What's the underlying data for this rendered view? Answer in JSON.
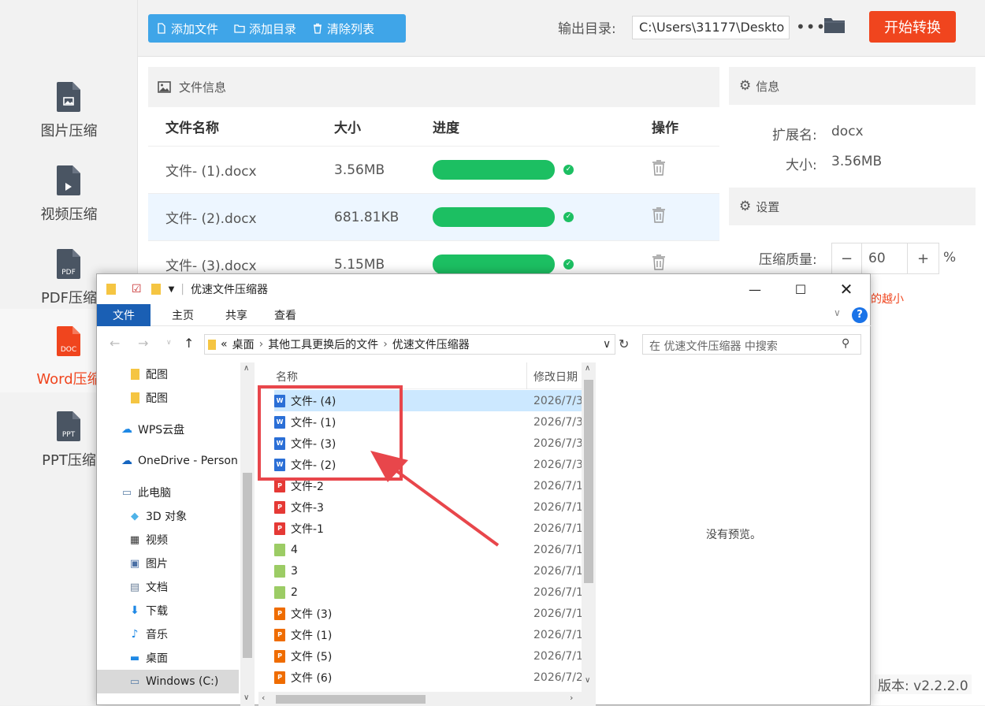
{
  "sidebar": {
    "items": [
      {
        "label": "图片压缩",
        "icon": "image-file-icon",
        "badge": ""
      },
      {
        "label": "视频压缩",
        "icon": "video-file-icon",
        "badge": ""
      },
      {
        "label": "PDF压缩",
        "icon": "pdf-file-icon",
        "badge": "PDF"
      },
      {
        "label": "Word压缩",
        "icon": "word-file-icon",
        "badge": "DOC"
      },
      {
        "label": "PPT压缩",
        "icon": "ppt-file-icon",
        "badge": "PPT"
      }
    ],
    "active_index": 3
  },
  "toolbar": {
    "add_file": "添加文件",
    "add_dir": "添加目录",
    "clear_list": "清除列表",
    "output_label": "输出目录:",
    "output_path": "C:\\Users\\31177\\Deskto",
    "more": "•••",
    "start": "开始转换"
  },
  "file_panel": {
    "title": "文件信息",
    "columns": [
      "文件名称",
      "大小",
      "进度",
      "操作"
    ],
    "rows": [
      {
        "name": "文件- (1).docx",
        "size": "3.56MB",
        "progress": 1.0,
        "selected": false
      },
      {
        "name": "文件- (2).docx",
        "size": "681.81KB",
        "progress": 1.0,
        "selected": true
      },
      {
        "name": "文件- (3).docx",
        "size": "5.15MB",
        "progress": 1.0,
        "selected": false
      }
    ]
  },
  "info_panel": {
    "title": "信息",
    "ext_label": "扩展名:",
    "ext_value": "docx",
    "size_label": "大小:",
    "size_value": "3.56MB"
  },
  "settings_panel": {
    "title": "设置",
    "quality_label": "压缩质量:",
    "quality_value": "60",
    "minus": "−",
    "plus": "+",
    "unit": "%",
    "hint_fragment": "的越小"
  },
  "version": "版本:  v2.2.2.0",
  "explorer": {
    "title": "优速文件压缩器",
    "ribbon_tabs": [
      "文件",
      "主页",
      "共享",
      "查看"
    ],
    "address": {
      "prefix": "«",
      "crumbs": [
        "桌面",
        "其他工具更换后的文件",
        "优速文件压缩器"
      ]
    },
    "search_placeholder": "在 优速文件压缩器 中搜索",
    "nav_items": [
      {
        "label": "配图",
        "icon": "folder-icon"
      },
      {
        "label": "配图",
        "icon": "folder-icon"
      },
      {
        "label": "WPS云盘",
        "icon": "cloud-icon"
      },
      {
        "label": "OneDrive - Person",
        "icon": "onedrive-icon"
      },
      {
        "label": "此电脑",
        "icon": "computer-icon"
      },
      {
        "label": "3D 对象",
        "icon": "3d-objects-icon"
      },
      {
        "label": "视频",
        "icon": "videos-icon"
      },
      {
        "label": "图片",
        "icon": "pictures-icon"
      },
      {
        "label": "文档",
        "icon": "documents-icon"
      },
      {
        "label": "下载",
        "icon": "downloads-icon"
      },
      {
        "label": "音乐",
        "icon": "music-icon"
      },
      {
        "label": "桌面",
        "icon": "desktop-icon"
      },
      {
        "label": "Windows (C:)",
        "icon": "drive-icon"
      }
    ],
    "list_headers": {
      "name": "名称",
      "date": "修改日期"
    },
    "files": [
      {
        "name": "文件- (4)",
        "date": "2026/7/3",
        "type": "word",
        "selected": true
      },
      {
        "name": "文件- (1)",
        "date": "2026/7/3",
        "type": "word",
        "selected": false
      },
      {
        "name": "文件- (3)",
        "date": "2026/7/3",
        "type": "word",
        "selected": false
      },
      {
        "name": "文件- (2)",
        "date": "2026/7/3",
        "type": "word",
        "selected": false
      },
      {
        "name": "文件-2",
        "date": "2026/7/1",
        "type": "pdf",
        "selected": false
      },
      {
        "name": "文件-3",
        "date": "2026/7/1",
        "type": "pdf",
        "selected": false
      },
      {
        "name": "文件-1",
        "date": "2026/7/1",
        "type": "pdf",
        "selected": false
      },
      {
        "name": "4",
        "date": "2026/7/1",
        "type": "image",
        "selected": false
      },
      {
        "name": "3",
        "date": "2026/7/1",
        "type": "image",
        "selected": false
      },
      {
        "name": "2",
        "date": "2026/7/1",
        "type": "image",
        "selected": false
      },
      {
        "name": "文件 (3)",
        "date": "2026/7/1",
        "type": "ppt",
        "selected": false
      },
      {
        "name": "文件 (1)",
        "date": "2026/7/1",
        "type": "ppt",
        "selected": false
      },
      {
        "name": "文件 (5)",
        "date": "2026/7/1",
        "type": "ppt",
        "selected": false
      },
      {
        "name": "文件 (6)",
        "date": "2026/7/2",
        "type": "ppt",
        "selected": false
      }
    ],
    "preview_text": "没有预览。"
  },
  "colors": {
    "accent_blue": "#3fa5e8",
    "start_orange": "#f0451e",
    "progress_green": "#1cbf62",
    "highlight_red": "#e8464b"
  }
}
